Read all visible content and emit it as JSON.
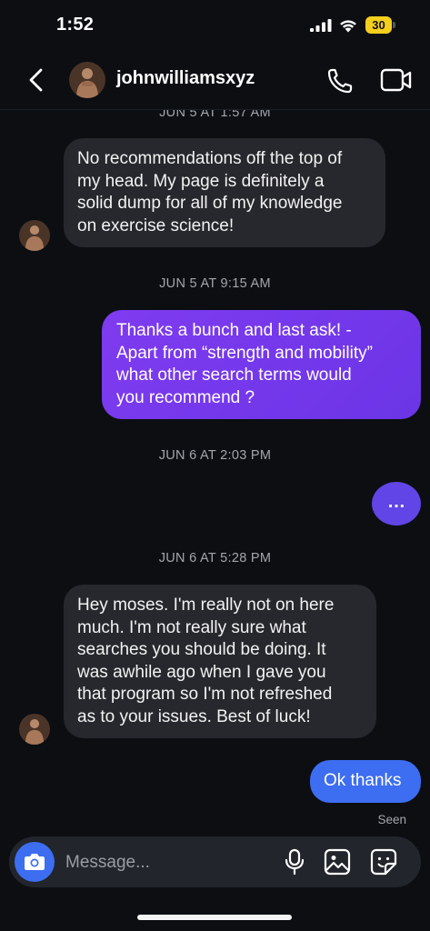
{
  "status_bar": {
    "time": "1:52",
    "battery_level": "30"
  },
  "header": {
    "username": "johnwilliamsxyz"
  },
  "thread": {
    "timestamp_top_partial": "JUN 5 AT 1:57 AM",
    "msg1": "No recommendations off the top of\nmy head. My page is definitely a\nsolid dump for all of my knowledge\non exercise science!",
    "ts2": "JUN 5 AT 9:15 AM",
    "msg2": "Thanks a bunch and last ask! -\nApart from “strength and mobility”\nwhat other search terms would\nyou recommend ?",
    "ts3": "JUN 6 AT 2:03 PM",
    "msg3": "…",
    "ts4": "JUN 6 AT 5:28 PM",
    "msg4": "Hey moses. I'm really not on here\nmuch. I'm not really sure what\nsearches you should be doing. It\nwas awhile ago when I gave you\nthat program so I'm not refreshed\nas to your issues. Best of luck!",
    "msg5": "Ok thanks",
    "seen": "Seen"
  },
  "composer": {
    "placeholder": "Message..."
  },
  "colors": {
    "background": "#0c0e12",
    "incoming_bubble": "#26282d",
    "outgoing_purple": "#7f3bf0",
    "outgoing_blue": "#3d6df0",
    "battery": "#f5cf1d"
  },
  "icons": [
    "back-chevron-icon",
    "phone-icon",
    "video-camera-icon",
    "camera-icon",
    "microphone-icon",
    "gallery-icon",
    "sticker-icon",
    "signal-icon",
    "wifi-icon",
    "battery-icon"
  ]
}
